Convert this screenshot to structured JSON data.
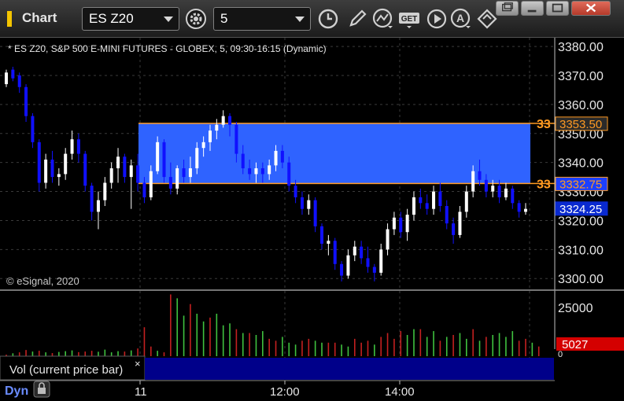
{
  "window": {
    "title": "Chart",
    "icon": "chart-icon"
  },
  "toolbar": {
    "symbol": "ES Z20",
    "interval": "5",
    "icons": [
      "settings-gear-icon",
      "clock-icon",
      "pencil-icon",
      "study-icon",
      "get-icon",
      "play-icon",
      "a-icon",
      "diamond-icon"
    ]
  },
  "window_controls": [
    "restore-icon",
    "minimize-icon",
    "maximize-icon",
    "close-icon"
  ],
  "chart_header": "* ES Z20, S&P 500 E-MINI FUTURES - GLOBEX, 5, 09:30-16:15 (Dynamic)",
  "copyright": "© eSignal, 2020",
  "price_axis": {
    "ticks": [
      "3380.00",
      "3370.00",
      "3360.00",
      "3350.00",
      "3340.00",
      "3330.00",
      "3320.00",
      "3310.00",
      "3300.00"
    ]
  },
  "price_tags": [
    {
      "label": "3353.50",
      "price": 3353.5,
      "color": "#2a2a2a",
      "text_color": "#ff9a22",
      "border": "#ff9a22"
    },
    {
      "label": "3332.75",
      "price": 3332.75,
      "color": "#1c3fff",
      "text_color": "#ff9a22",
      "border": "#ff9a22"
    },
    {
      "label": "3324.25",
      "price": 3324.25,
      "color": "#0a2ad0",
      "text_color": "#ffffff",
      "border": "#0a2ad0"
    }
  ],
  "zone_labels": [
    {
      "label": "33",
      "price": 3353.5
    },
    {
      "label": "33",
      "price": 3332.75
    }
  ],
  "zone": {
    "top": 3353.5,
    "bottom": 3332.75,
    "fill": "#2f63ff",
    "border": "#ff9a22"
  },
  "volume_axis": {
    "ticks": [
      "25000",
      "0"
    ]
  },
  "volume_tag": {
    "label": "5027",
    "color": "#d40000"
  },
  "study_panel": {
    "label": "Vol (current price bar)",
    "close": "×"
  },
  "time_axis": {
    "labels": [
      "11",
      "12:00",
      "14:00"
    ]
  },
  "footer": {
    "mode": "Dyn"
  },
  "colors": {
    "up": "#ffffff",
    "down": "#1010ff",
    "vol_up": "#3fc23f",
    "vol_down": "#c42020"
  },
  "chart_data": {
    "type": "candlestick",
    "price_range": [
      3296,
      3383
    ],
    "volume_range": [
      0,
      33000
    ],
    "bars": [
      {
        "o": 3367,
        "h": 3372,
        "l": 3366,
        "c": 3371
      },
      {
        "o": 3372,
        "h": 3373,
        "l": 3368,
        "c": 3369
      },
      {
        "o": 3370,
        "h": 3371,
        "l": 3364,
        "c": 3366
      },
      {
        "o": 3366,
        "h": 3367,
        "l": 3354,
        "c": 3356
      },
      {
        "o": 3356,
        "h": 3357,
        "l": 3345,
        "c": 3347
      },
      {
        "o": 3347,
        "h": 3348,
        "l": 3330,
        "c": 3333
      },
      {
        "o": 3333,
        "h": 3343,
        "l": 3331,
        "c": 3341
      },
      {
        "o": 3341,
        "h": 3344,
        "l": 3333,
        "c": 3335
      },
      {
        "o": 3335,
        "h": 3338,
        "l": 3332,
        "c": 3336
      },
      {
        "o": 3336,
        "h": 3345,
        "l": 3334,
        "c": 3343
      },
      {
        "o": 3343,
        "h": 3351,
        "l": 3341,
        "c": 3348
      },
      {
        "o": 3348,
        "h": 3350,
        "l": 3340,
        "c": 3343
      },
      {
        "o": 3343,
        "h": 3344,
        "l": 3330,
        "c": 3332
      },
      {
        "o": 3332,
        "h": 3333,
        "l": 3320,
        "c": 3323
      },
      {
        "o": 3323,
        "h": 3330,
        "l": 3317,
        "c": 3327
      },
      {
        "o": 3327,
        "h": 3335,
        "l": 3325,
        "c": 3333
      },
      {
        "o": 3333,
        "h": 3340,
        "l": 3331,
        "c": 3338
      },
      {
        "o": 3338,
        "h": 3345,
        "l": 3333,
        "c": 3342
      },
      {
        "o": 3342,
        "h": 3343,
        "l": 3333,
        "c": 3335
      },
      {
        "o": 3335,
        "h": 3341,
        "l": 3324,
        "c": 3339
      },
      {
        "o": 3339,
        "h": 3343,
        "l": 3330,
        "c": 3333
      },
      {
        "o": 3333,
        "h": 3335,
        "l": 3326,
        "c": 3328
      },
      {
        "o": 3328,
        "h": 3339,
        "l": 3327,
        "c": 3337
      },
      {
        "o": 3337,
        "h": 3349,
        "l": 3336,
        "c": 3347
      },
      {
        "o": 3347,
        "h": 3348,
        "l": 3333,
        "c": 3335
      },
      {
        "o": 3335,
        "h": 3340,
        "l": 3329,
        "c": 3331
      },
      {
        "o": 3331,
        "h": 3339,
        "l": 3329,
        "c": 3338
      },
      {
        "o": 3338,
        "h": 3341,
        "l": 3333,
        "c": 3335
      },
      {
        "o": 3335,
        "h": 3342,
        "l": 3333,
        "c": 3338
      },
      {
        "o": 3338,
        "h": 3347,
        "l": 3336,
        "c": 3345
      },
      {
        "o": 3345,
        "h": 3349,
        "l": 3342,
        "c": 3347
      },
      {
        "o": 3347,
        "h": 3353,
        "l": 3344,
        "c": 3351
      },
      {
        "o": 3351,
        "h": 3355,
        "l": 3348,
        "c": 3353
      },
      {
        "o": 3353,
        "h": 3358,
        "l": 3352,
        "c": 3356
      },
      {
        "o": 3356,
        "h": 3357,
        "l": 3349,
        "c": 3353
      },
      {
        "o": 3353,
        "h": 3354,
        "l": 3340,
        "c": 3343
      },
      {
        "o": 3343,
        "h": 3346,
        "l": 3336,
        "c": 3338
      },
      {
        "o": 3338,
        "h": 3341,
        "l": 3334,
        "c": 3336
      },
      {
        "o": 3336,
        "h": 3340,
        "l": 3333,
        "c": 3338
      },
      {
        "o": 3338,
        "h": 3340,
        "l": 3333,
        "c": 3336
      },
      {
        "o": 3336,
        "h": 3341,
        "l": 3334,
        "c": 3339
      },
      {
        "o": 3339,
        "h": 3346,
        "l": 3337,
        "c": 3344
      },
      {
        "o": 3344,
        "h": 3346,
        "l": 3338,
        "c": 3340
      },
      {
        "o": 3340,
        "h": 3342,
        "l": 3330,
        "c": 3332
      },
      {
        "o": 3332,
        "h": 3334,
        "l": 3326,
        "c": 3328
      },
      {
        "o": 3328,
        "h": 3330,
        "l": 3322,
        "c": 3324
      },
      {
        "o": 3324,
        "h": 3329,
        "l": 3322,
        "c": 3327
      },
      {
        "o": 3327,
        "h": 3328,
        "l": 3316,
        "c": 3318
      },
      {
        "o": 3318,
        "h": 3319,
        "l": 3310,
        "c": 3312
      },
      {
        "o": 3312,
        "h": 3315,
        "l": 3308,
        "c": 3313
      },
      {
        "o": 3313,
        "h": 3314,
        "l": 3303,
        "c": 3305
      },
      {
        "o": 3305,
        "h": 3306,
        "l": 3299,
        "c": 3301
      },
      {
        "o": 3301,
        "h": 3310,
        "l": 3300,
        "c": 3308
      },
      {
        "o": 3308,
        "h": 3313,
        "l": 3306,
        "c": 3311
      },
      {
        "o": 3311,
        "h": 3313,
        "l": 3305,
        "c": 3307
      },
      {
        "o": 3307,
        "h": 3311,
        "l": 3302,
        "c": 3304
      },
      {
        "o": 3304,
        "h": 3305,
        "l": 3299,
        "c": 3302
      },
      {
        "o": 3302,
        "h": 3312,
        "l": 3301,
        "c": 3310
      },
      {
        "o": 3310,
        "h": 3319,
        "l": 3308,
        "c": 3317
      },
      {
        "o": 3317,
        "h": 3323,
        "l": 3315,
        "c": 3321
      },
      {
        "o": 3321,
        "h": 3323,
        "l": 3314,
        "c": 3316
      },
      {
        "o": 3316,
        "h": 3324,
        "l": 3313,
        "c": 3322
      },
      {
        "o": 3322,
        "h": 3330,
        "l": 3320,
        "c": 3328
      },
      {
        "o": 3328,
        "h": 3331,
        "l": 3324,
        "c": 3326
      },
      {
        "o": 3326,
        "h": 3329,
        "l": 3322,
        "c": 3324
      },
      {
        "o": 3324,
        "h": 3332,
        "l": 3322,
        "c": 3330
      },
      {
        "o": 3330,
        "h": 3333,
        "l": 3323,
        "c": 3325
      },
      {
        "o": 3325,
        "h": 3327,
        "l": 3317,
        "c": 3319
      },
      {
        "o": 3319,
        "h": 3321,
        "l": 3312,
        "c": 3315
      },
      {
        "o": 3315,
        "h": 3325,
        "l": 3314,
        "c": 3323
      },
      {
        "o": 3323,
        "h": 3332,
        "l": 3321,
        "c": 3330
      },
      {
        "o": 3330,
        "h": 3339,
        "l": 3328,
        "c": 3337
      },
      {
        "o": 3337,
        "h": 3341,
        "l": 3332,
        "c": 3334
      },
      {
        "o": 3334,
        "h": 3336,
        "l": 3328,
        "c": 3330
      },
      {
        "o": 3330,
        "h": 3334,
        "l": 3328,
        "c": 3332
      },
      {
        "o": 3332,
        "h": 3334,
        "l": 3326,
        "c": 3328
      },
      {
        "o": 3328,
        "h": 3333,
        "l": 3327,
        "c": 3331
      },
      {
        "o": 3331,
        "h": 3332,
        "l": 3324,
        "c": 3326
      },
      {
        "o": 3326,
        "h": 3327,
        "l": 3321,
        "c": 3323
      },
      {
        "o": 3323,
        "h": 3326,
        "l": 3322,
        "c": 3324
      }
    ],
    "volumes": [
      {
        "v": 800,
        "up": false
      },
      {
        "v": 1500,
        "up": true
      },
      {
        "v": 2000,
        "up": false
      },
      {
        "v": 3200,
        "up": false
      },
      {
        "v": 2400,
        "up": true
      },
      {
        "v": 2800,
        "up": false
      },
      {
        "v": 2000,
        "up": true
      },
      {
        "v": 1600,
        "up": false
      },
      {
        "v": 2200,
        "up": true
      },
      {
        "v": 2600,
        "up": true
      },
      {
        "v": 3000,
        "up": true
      },
      {
        "v": 2100,
        "up": false
      },
      {
        "v": 2400,
        "up": false
      },
      {
        "v": 2800,
        "up": false
      },
      {
        "v": 2300,
        "up": true
      },
      {
        "v": 3400,
        "up": true
      },
      {
        "v": 2000,
        "up": true
      },
      {
        "v": 2600,
        "up": true
      },
      {
        "v": 2400,
        "up": false
      },
      {
        "v": 3000,
        "up": true
      },
      {
        "v": 4000,
        "up": false
      },
      {
        "v": 15000,
        "up": false
      },
      {
        "v": 5000,
        "up": false
      },
      {
        "v": 2800,
        "up": true
      },
      {
        "v": 2000,
        "up": false
      },
      {
        "v": 32000,
        "up": false
      },
      {
        "v": 30000,
        "up": true
      },
      {
        "v": 21000,
        "up": true
      },
      {
        "v": 27000,
        "up": false
      },
      {
        "v": 22000,
        "up": true
      },
      {
        "v": 18000,
        "up": true
      },
      {
        "v": 20000,
        "up": false
      },
      {
        "v": 22000,
        "up": true
      },
      {
        "v": 16000,
        "up": true
      },
      {
        "v": 17000,
        "up": true
      },
      {
        "v": 14000,
        "up": false
      },
      {
        "v": 12000,
        "up": true
      },
      {
        "v": 12000,
        "up": false
      },
      {
        "v": 11000,
        "up": true
      },
      {
        "v": 13000,
        "up": true
      },
      {
        "v": 9000,
        "up": false
      },
      {
        "v": 8000,
        "up": false
      },
      {
        "v": 10000,
        "up": true
      },
      {
        "v": 7000,
        "up": true
      },
      {
        "v": 6000,
        "up": true
      },
      {
        "v": 8000,
        "up": false
      },
      {
        "v": 9000,
        "up": false
      },
      {
        "v": 8000,
        "up": true
      },
      {
        "v": 7000,
        "up": true
      },
      {
        "v": 7000,
        "up": false
      },
      {
        "v": 7000,
        "up": false
      },
      {
        "v": 6000,
        "up": true
      },
      {
        "v": 5000,
        "up": true
      },
      {
        "v": 9000,
        "up": false
      },
      {
        "v": 7000,
        "up": false
      },
      {
        "v": 8000,
        "up": false
      },
      {
        "v": 6000,
        "up": true
      },
      {
        "v": 10000,
        "up": false
      },
      {
        "v": 12000,
        "up": false
      },
      {
        "v": 9000,
        "up": false
      },
      {
        "v": 13000,
        "up": false
      },
      {
        "v": 11000,
        "up": true
      },
      {
        "v": 14000,
        "up": true
      },
      {
        "v": 14000,
        "up": false
      },
      {
        "v": 10000,
        "up": true
      },
      {
        "v": 13000,
        "up": true
      },
      {
        "v": 8000,
        "up": false
      },
      {
        "v": 10000,
        "up": true
      },
      {
        "v": 11000,
        "up": false
      },
      {
        "v": 12000,
        "up": true
      },
      {
        "v": 9000,
        "up": true
      },
      {
        "v": 14000,
        "up": false
      },
      {
        "v": 8000,
        "up": true
      },
      {
        "v": 10000,
        "up": false
      },
      {
        "v": 11000,
        "up": true
      },
      {
        "v": 12000,
        "up": true
      },
      {
        "v": 10000,
        "up": true
      },
      {
        "v": 13000,
        "up": true
      },
      {
        "v": 8000,
        "up": false
      },
      {
        "v": 9000,
        "up": false
      },
      {
        "v": 7000,
        "up": true
      },
      {
        "v": 5027,
        "up": false
      }
    ]
  }
}
